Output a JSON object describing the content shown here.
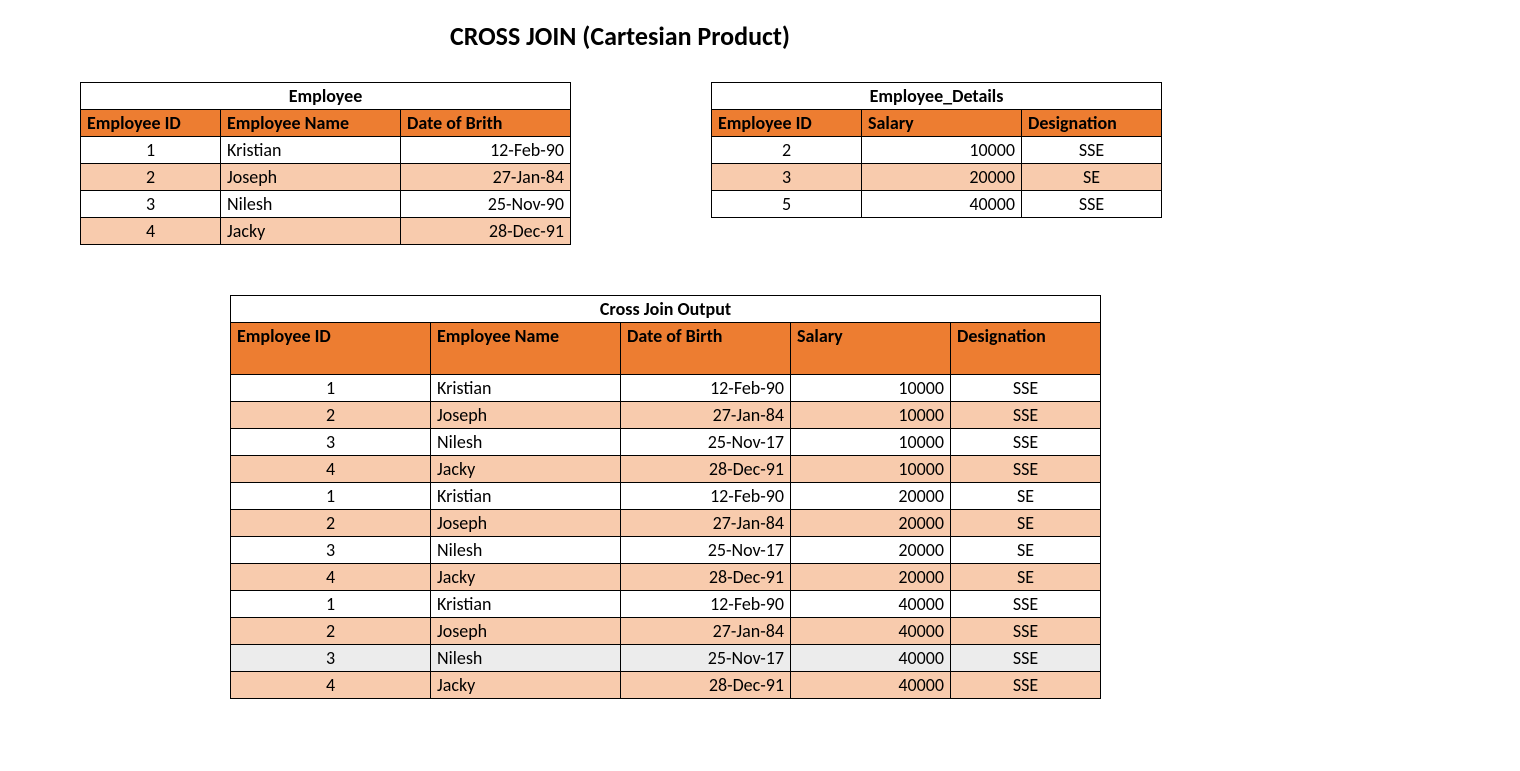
{
  "title": "CROSS JOIN (Cartesian Product)",
  "employee_table": {
    "title": "Employee",
    "headers": [
      "Employee ID",
      "Employee Name",
      "Date of Brith"
    ],
    "rows": [
      {
        "id": "1",
        "name": "Kristian",
        "dob": "12-Feb-90"
      },
      {
        "id": "2",
        "name": "Joseph",
        "dob": "27-Jan-84"
      },
      {
        "id": "3",
        "name": "Nilesh",
        "dob": "25-Nov-90"
      },
      {
        "id": "4",
        "name": "Jacky",
        "dob": "28-Dec-91"
      }
    ]
  },
  "details_table": {
    "title": "Employee_Details",
    "headers": [
      "Employee ID",
      "Salary",
      "Designation"
    ],
    "rows": [
      {
        "id": "2",
        "salary": "10000",
        "desig": "SSE"
      },
      {
        "id": "3",
        "salary": "20000",
        "desig": "SE"
      },
      {
        "id": "5",
        "salary": "40000",
        "desig": "SSE"
      }
    ]
  },
  "output_table": {
    "title": "Cross Join Output",
    "headers": [
      "Employee ID",
      "Employee Name",
      "Date of Birth",
      "Salary",
      "Designation"
    ],
    "rows": [
      {
        "id": "1",
        "name": "Kristian",
        "dob": "12-Feb-90",
        "salary": "10000",
        "desig": "SSE",
        "shade": "odd"
      },
      {
        "id": "2",
        "name": "Joseph",
        "dob": "27-Jan-84",
        "salary": "10000",
        "desig": "SSE",
        "shade": "even"
      },
      {
        "id": "3",
        "name": "Nilesh",
        "dob": "25-Nov-17",
        "salary": "10000",
        "desig": "SSE",
        "shade": "odd"
      },
      {
        "id": "4",
        "name": "Jacky",
        "dob": "28-Dec-91",
        "salary": "10000",
        "desig": "SSE",
        "shade": "even"
      },
      {
        "id": "1",
        "name": "Kristian",
        "dob": "12-Feb-90",
        "salary": "20000",
        "desig": "SE",
        "shade": "odd"
      },
      {
        "id": "2",
        "name": "Joseph",
        "dob": "27-Jan-84",
        "salary": "20000",
        "desig": "SE",
        "shade": "even"
      },
      {
        "id": "3",
        "name": "Nilesh",
        "dob": "25-Nov-17",
        "salary": "20000",
        "desig": "SE",
        "shade": "odd"
      },
      {
        "id": "4",
        "name": "Jacky",
        "dob": "28-Dec-91",
        "salary": "20000",
        "desig": "SE",
        "shade": "even"
      },
      {
        "id": "1",
        "name": "Kristian",
        "dob": "12-Feb-90",
        "salary": "40000",
        "desig": "SSE",
        "shade": "odd"
      },
      {
        "id": "2",
        "name": "Joseph",
        "dob": "27-Jan-84",
        "salary": "40000",
        "desig": "SSE",
        "shade": "even"
      },
      {
        "id": "3",
        "name": "Nilesh",
        "dob": "25-Nov-17",
        "salary": "40000",
        "desig": "SSE",
        "shade": "gray"
      },
      {
        "id": "4",
        "name": "Jacky",
        "dob": "28-Dec-91",
        "salary": "40000",
        "desig": "SSE",
        "shade": "even"
      }
    ]
  }
}
